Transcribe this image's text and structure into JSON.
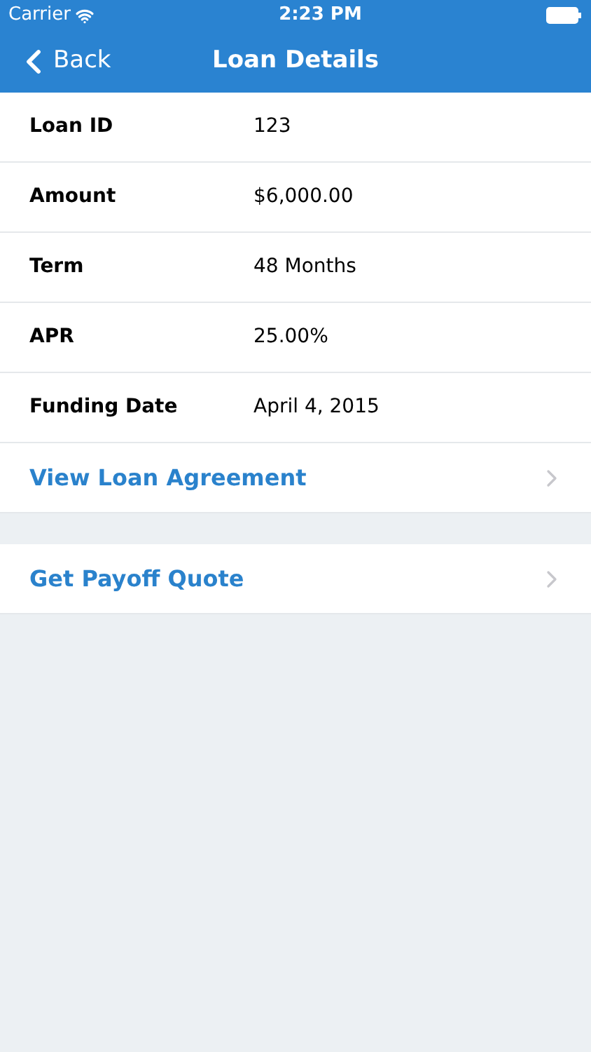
{
  "status_bar": {
    "carrier": "Carrier",
    "time": "2:23 PM"
  },
  "nav": {
    "back": "Back",
    "title": "Loan Details"
  },
  "details": [
    {
      "label": "Loan ID",
      "value": "123"
    },
    {
      "label": "Amount",
      "value": "$6,000.00"
    },
    {
      "label": "Term",
      "value": "48 Months"
    },
    {
      "label": "APR",
      "value": "25.00%"
    },
    {
      "label": "Funding Date",
      "value": "April 4, 2015"
    }
  ],
  "link_groups": [
    [
      {
        "label": "View Loan Agreement"
      }
    ],
    [
      {
        "label": "Get Payoff Quote"
      }
    ]
  ]
}
